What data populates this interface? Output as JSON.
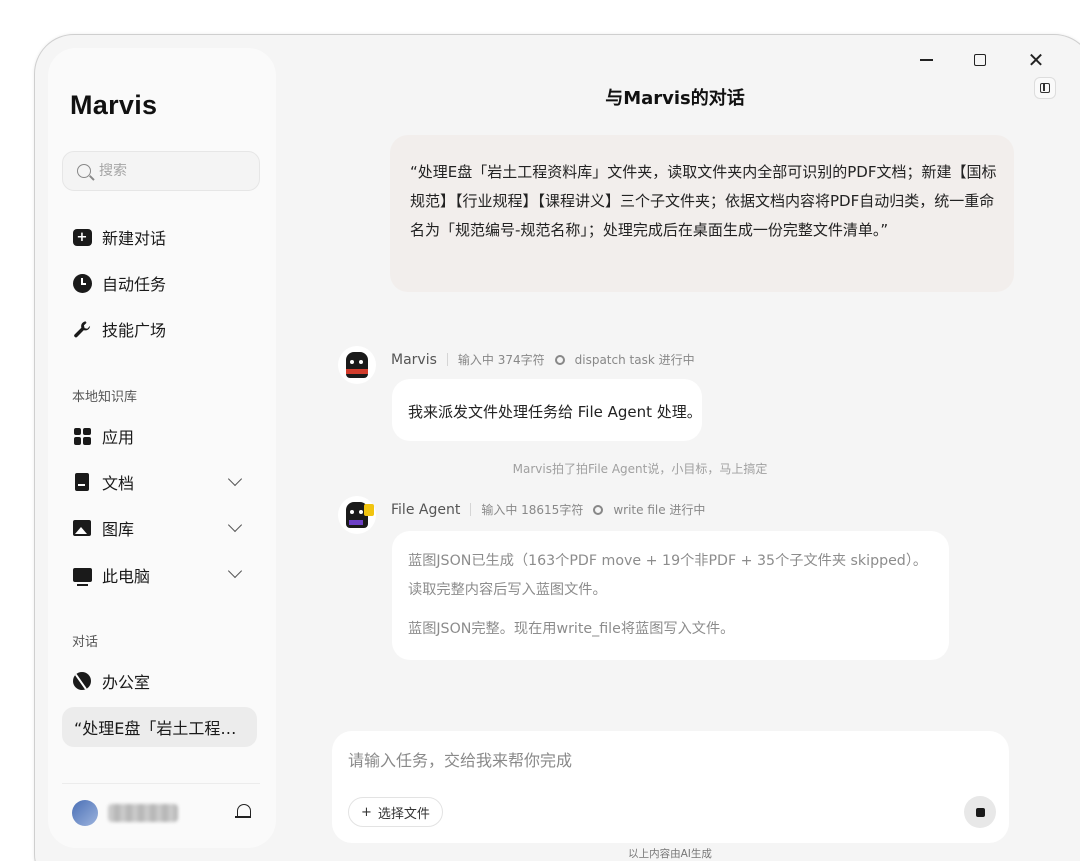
{
  "app": {
    "brand": "Marvis"
  },
  "window": {
    "minimize": "—",
    "close": "✕"
  },
  "sidebar": {
    "search_placeholder": "搜索",
    "nav": [
      {
        "label": "新建对话",
        "icon": "new-chat-icon"
      },
      {
        "label": "自动任务",
        "icon": "clock-icon"
      },
      {
        "label": "技能广场",
        "icon": "wrench-icon"
      }
    ],
    "knowledge_label": "本地知识库",
    "knowledge": [
      {
        "label": "应用",
        "icon": "apps-grid-icon"
      },
      {
        "label": "文档",
        "icon": "document-icon"
      },
      {
        "label": "图库",
        "icon": "image-icon"
      },
      {
        "label": "此电脑",
        "icon": "monitor-icon"
      }
    ],
    "conversations_label": "对话",
    "conversations": [
      {
        "label": "办公室",
        "icon": "office-icon"
      },
      {
        "label": "“处理E盘「岩土工程…"
      }
    ]
  },
  "main": {
    "title": "与Marvis的对话",
    "user_message": "“处理E盘「岩土工程资料库」文件夹，读取文件夹内全部可识别的PDF文档；新建【国标规范】【行业规程】【课程讲义】三个子文件夹；依据文档内容将PDF自动归类，统一重命名为「规范编号-规范名称」；处理完成后在桌面生成一份完整文件清单。”",
    "messages": [
      {
        "sender": "Marvis",
        "input_status": "输入中 374字符",
        "task_status": "dispatch task 进行中",
        "text": "我来派发文件处理任务给 File Agent 处理。"
      },
      {
        "sender": "File Agent",
        "input_status": "输入中 18615字符",
        "task_status": "write file 进行中",
        "text_1": "蓝图JSON已生成（163个PDF move + 19个非PDF + 35个子文件夹 skipped）。读取完整内容后写入蓝图文件。",
        "text_2": "蓝图JSON完整。现在用write_file将蓝图写入文件。"
      }
    ],
    "aside_note": "Marvis拍了拍File Agent说，小目标，马上搞定",
    "composer": {
      "placeholder": "请输入任务，交给我来帮你完成",
      "pick_files_label": "选择文件",
      "pick_files_icon": "+"
    },
    "footnote": "以上内容由AI生成"
  }
}
